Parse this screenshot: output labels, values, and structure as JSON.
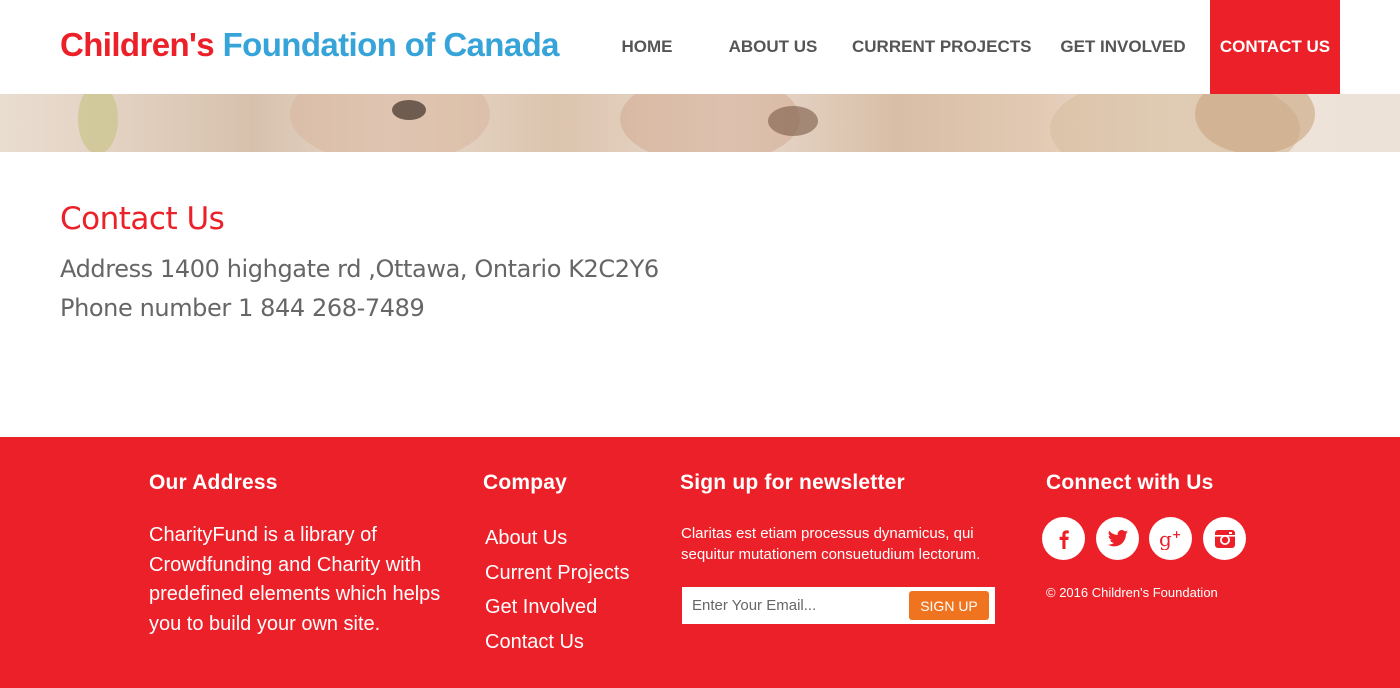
{
  "header": {
    "logo_part1": "Children's",
    "logo_part2": "Foundation of Canada",
    "nav": [
      {
        "label": "HOME"
      },
      {
        "label": "ABOUT US"
      },
      {
        "label": "CURRENT PROJECTS"
      },
      {
        "label": "GET INVOLVED"
      },
      {
        "label": "CONTACT US"
      }
    ]
  },
  "contact": {
    "title": "Contact Us",
    "address": "Address 1400 highgate rd ,Ottawa,  Ontario K2C2Y6",
    "phone": "Phone number 1 844 268-7489"
  },
  "footer": {
    "address_heading": "Our Address",
    "address_text": "CharityFund is a library of Crowdfunding and Charity with predefined elements which helps you to build your own site.",
    "company_heading": "Compay",
    "company_links": [
      {
        "label": "About Us"
      },
      {
        "label": "Current Projects"
      },
      {
        "label": "Get Involved"
      },
      {
        "label": "Contact Us"
      }
    ],
    "newsletter_heading": "Sign up for newsletter",
    "newsletter_text": "Claritas est etiam processus dynamicus, qui sequitur mutationem consuetudium lectorum.",
    "newsletter_placeholder": "Enter Your Email...",
    "newsletter_button": "SIGN UP",
    "connect_heading": "Connect with Us",
    "social_icons": [
      "facebook-icon",
      "twitter-icon",
      "google-plus-icon",
      "instagram-icon"
    ],
    "copyright": "© 2016  Children's Foundation"
  },
  "colors": {
    "brand_red": "#ec2028",
    "brand_blue": "#36a4d8",
    "button_orange": "#f0741f"
  }
}
